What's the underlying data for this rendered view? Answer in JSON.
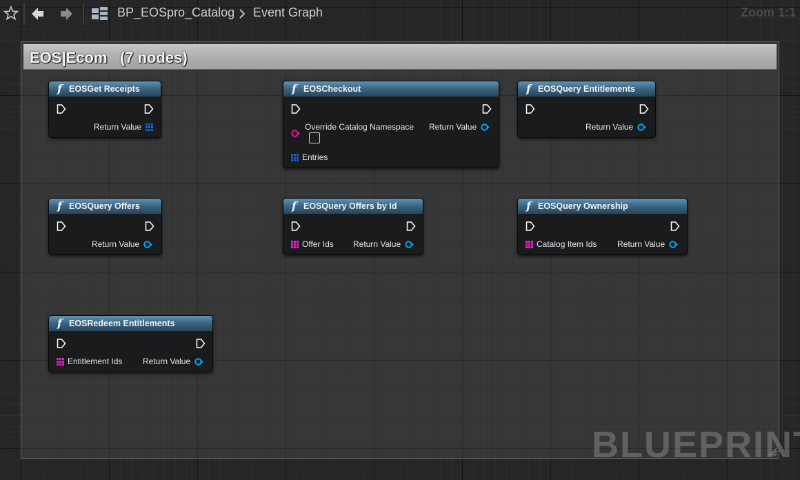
{
  "toolbar": {
    "blueprint_name": "BP_EOSpro_Catalog",
    "graph_name": "Event Graph",
    "zoom": "Zoom 1:1"
  },
  "comment": {
    "title": "EOS|Ecom   (7 nodes)"
  },
  "watermark": "BLUEPRINT",
  "colors": {
    "exec": "#ffffff",
    "struct_array": "#0b62d6",
    "object": "#00a6f5",
    "string": "#f0148c",
    "name_array": "#e624c8",
    "node_header": "#3d6785"
  },
  "nodes": [
    {
      "title": "EOSGet Receipts",
      "outputs": [
        "Return Value"
      ],
      "inputs": []
    },
    {
      "title": "EOSCheckout",
      "inputs": [
        "Override Catalog Namespace",
        "Entries"
      ],
      "outputs": [
        "Return Value"
      ]
    },
    {
      "title": "EOSQuery Entitlements",
      "inputs": [],
      "outputs": [
        "Return Value"
      ]
    },
    {
      "title": "EOSQuery Offers",
      "inputs": [],
      "outputs": [
        "Return Value"
      ]
    },
    {
      "title": "EOSQuery Offers by Id",
      "inputs": [
        "Offer Ids"
      ],
      "outputs": [
        "Return Value"
      ]
    },
    {
      "title": "EOSQuery Ownership",
      "inputs": [
        "Catalog Item Ids"
      ],
      "outputs": [
        "Return Value"
      ]
    },
    {
      "title": "EOSRedeem Entitlements",
      "inputs": [
        "Entitlement Ids"
      ],
      "outputs": [
        "Return Value"
      ]
    }
  ]
}
